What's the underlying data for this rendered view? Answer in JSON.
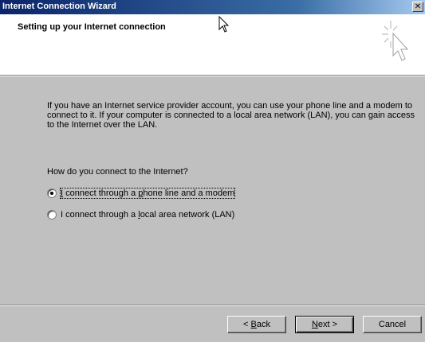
{
  "window": {
    "title": "Internet Connection Wizard",
    "close_glyph": "✕"
  },
  "header": {
    "title": "Setting up your Internet connection",
    "icon": "wizard-cursor-sparkle-icon"
  },
  "content": {
    "description": "If you have an Internet service provider account, you can use your phone line and a modem to connect to it. If your computer is connected to a local area network (LAN), you can gain access to the Internet over the LAN.",
    "question": "How do you connect to the Internet?",
    "options": [
      {
        "pre": "",
        "key": "I",
        "post": " connect through a ",
        "key2": "p",
        "post2": "hone line and a modem",
        "selected": true
      },
      {
        "pre": "I connect through a ",
        "key": "l",
        "post": "ocal area network (LAN)",
        "key2": "",
        "post2": "",
        "selected": false
      }
    ]
  },
  "buttons": {
    "back": {
      "pre": "< ",
      "key": "B",
      "post": "ack"
    },
    "next": {
      "pre": "",
      "key": "N",
      "post": "ext >"
    },
    "cancel": "Cancel"
  }
}
